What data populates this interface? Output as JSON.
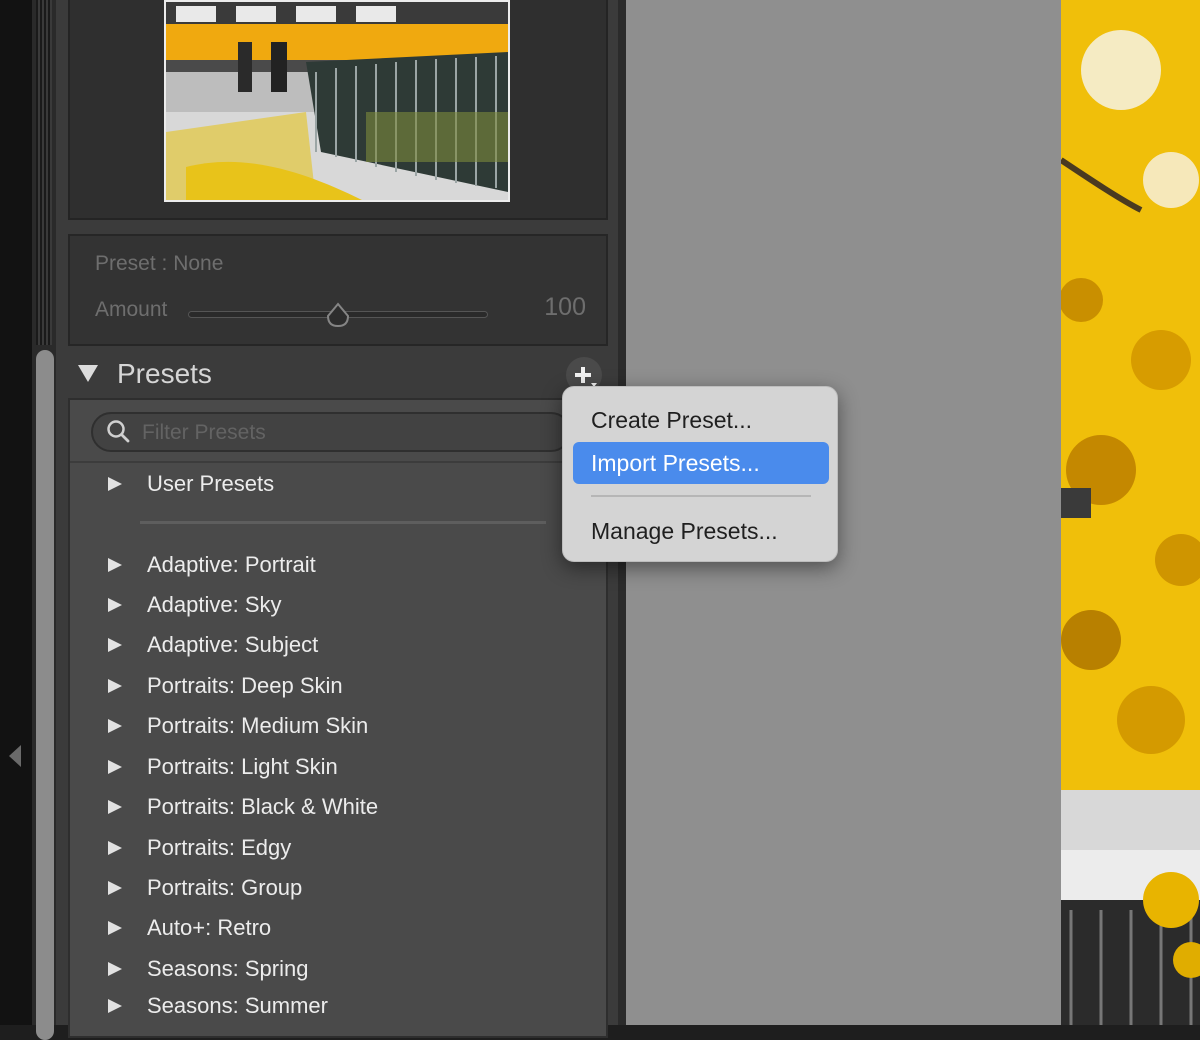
{
  "quick_develop": {
    "preset_label": "Preset : None",
    "amount_label": "Amount",
    "amount_value": "100",
    "amount_fraction": 0.5
  },
  "presets_panel": {
    "title": "Presets",
    "filter_placeholder": "Filter Presets",
    "user_group": "User Presets",
    "groups": [
      "Adaptive: Portrait",
      "Adaptive: Sky",
      "Adaptive: Subject",
      "Portraits: Deep Skin",
      "Portraits: Medium Skin",
      "Portraits: Light Skin",
      "Portraits: Black & White",
      "Portraits: Edgy",
      "Portraits: Group",
      "Auto+: Retro",
      "Seasons: Spring",
      "Seasons: Summer"
    ]
  },
  "context_menu": {
    "items": [
      "Create Preset...",
      "Import Presets...",
      "Manage Presets..."
    ],
    "active_index": 1
  },
  "icons": {
    "add": "plus-dropdown-icon",
    "search": "search-icon",
    "expand": "disclosure-triangle-icon",
    "collapse_panel": "left-arrow-icon"
  },
  "colors": {
    "highlight": "#4a8bec",
    "panel_bg": "#3b3b3b",
    "list_bg": "#4a4a4a",
    "canvas_bg": "#8f8f8f",
    "foliage": "#e6b400"
  }
}
